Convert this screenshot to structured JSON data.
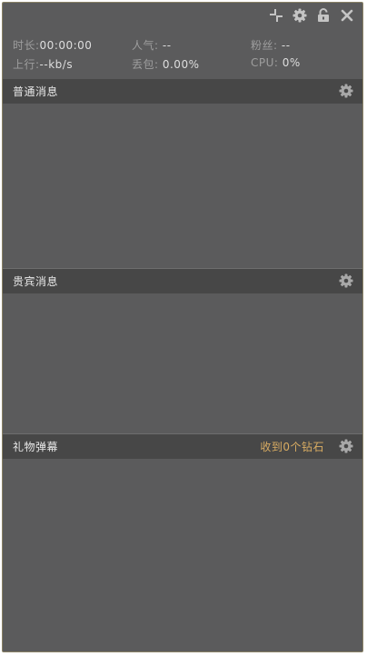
{
  "window": {
    "controls": [
      {
        "icon": "compact-icon"
      },
      {
        "icon": "gear-icon"
      },
      {
        "icon": "unlock-icon"
      },
      {
        "icon": "close-icon"
      }
    ]
  },
  "stats": {
    "duration": {
      "label": "时长:",
      "value": "00:00:00"
    },
    "popularity": {
      "label": "人气: ",
      "value": "--"
    },
    "fans": {
      "label": "粉丝: ",
      "value": "--"
    },
    "upload": {
      "label": "上行:",
      "value": "--kb/s"
    },
    "packet_loss": {
      "label": "丢包: ",
      "value": "0.00%"
    },
    "cpu": {
      "label": "CPU: ",
      "value": "0%"
    }
  },
  "panels": [
    {
      "title": "普通消息",
      "extra": ""
    },
    {
      "title": "贵宾消息",
      "extra": ""
    },
    {
      "title": "礼物弹幕",
      "extra": "收到0个钻石"
    }
  ],
  "colors": {
    "background": "#5b5b5c",
    "header": "#474747",
    "accent": "#d9ac62",
    "border": "#8a8266"
  }
}
